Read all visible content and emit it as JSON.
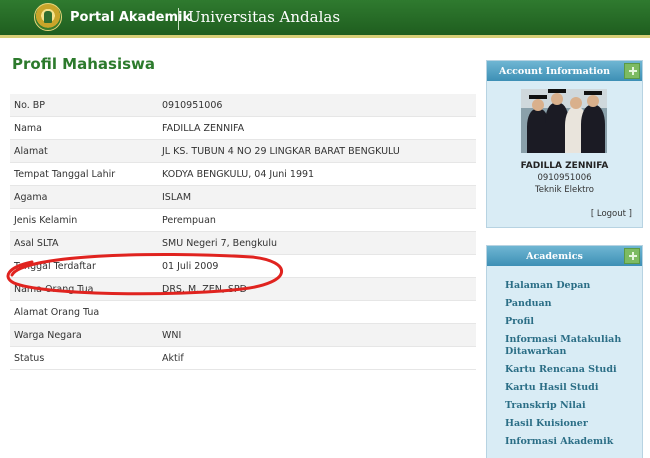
{
  "header": {
    "portal_title": "Portal Akademik",
    "university": "Universitas Andalas"
  },
  "main": {
    "page_title": "Profil Mahasiswa",
    "rows": [
      {
        "label": "No. BP",
        "value": "0910951006"
      },
      {
        "label": "Nama",
        "value": "FADILLA ZENNIFA"
      },
      {
        "label": "Alamat",
        "value": "JL KS. TUBUN 4 NO 29 LINGKAR BARAT BENGKULU"
      },
      {
        "label": "Tempat Tanggal Lahir",
        "value": "KODYA BENGKULU, 04 Juni 1991"
      },
      {
        "label": "Agama",
        "value": "ISLAM"
      },
      {
        "label": "Jenis Kelamin",
        "value": "Perempuan"
      },
      {
        "label": "Asal SLTA",
        "value": "SMU Negeri 7, Bengkulu"
      },
      {
        "label": "Tanggal Terdaftar",
        "value": "01 Juli 2009"
      },
      {
        "label": "Nama Orang Tua",
        "value": "DRS. M. ZEN, SPD"
      },
      {
        "label": "Alamat Orang Tua",
        "value": ""
      },
      {
        "label": "Warga Negara",
        "value": "WNI"
      },
      {
        "label": "Status",
        "value": "Aktif"
      }
    ]
  },
  "sidebar": {
    "account": {
      "title": "Account Information",
      "name": "FADILLA ZENNIFA",
      "id": "0910951006",
      "department": "Teknik Elektro",
      "logout_label": "[ Logout ]"
    },
    "academics": {
      "title": "Academics",
      "items": [
        {
          "label": "Halaman Depan"
        },
        {
          "label": "Panduan"
        },
        {
          "label": "Profil"
        },
        {
          "label": "Informasi Matakuliah Ditawarkan"
        },
        {
          "label": "Kartu Rencana Studi"
        },
        {
          "label": "Kartu Hasil Studi"
        },
        {
          "label": "Transkrip Nilai"
        },
        {
          "label": "Hasil Kuisioner"
        },
        {
          "label": "Informasi Akademik"
        }
      ]
    }
  },
  "colors": {
    "header_green": "#1f5e1f",
    "title_green": "#2c7a2c",
    "panel_blue": "#3d8fb5",
    "panel_bg": "#d9ecf5",
    "menu_link": "#2b6e86",
    "annotation_red": "#e0231f"
  }
}
